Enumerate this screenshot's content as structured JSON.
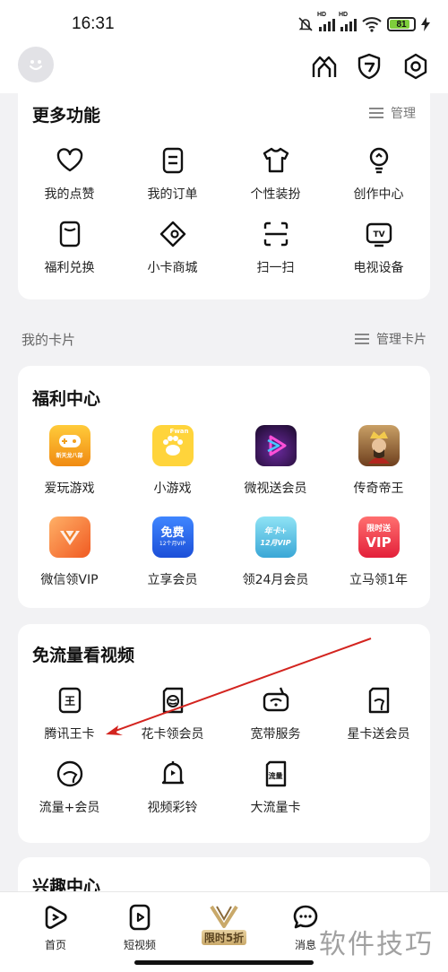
{
  "status_bar": {
    "time": "16:31",
    "battery": "81",
    "hd": "HD"
  },
  "top_bar": {
    "icons": [
      "avatar-icon",
      "pixel-icon",
      "shield-icon",
      "settings-icon"
    ]
  },
  "more_functions": {
    "title": "更多功能",
    "manage": "管理",
    "items": [
      {
        "label": "我的点赞",
        "icon": "heart-icon"
      },
      {
        "label": "我的订单",
        "icon": "order-icon"
      },
      {
        "label": "个性装扮",
        "icon": "tshirt-icon"
      },
      {
        "label": "创作中心",
        "icon": "bulb-icon"
      },
      {
        "label": "福利兑换",
        "icon": "exchange-icon"
      },
      {
        "label": "小卡商城",
        "icon": "ticket-icon"
      },
      {
        "label": "扫一扫",
        "icon": "scan-icon"
      },
      {
        "label": "电视设备",
        "icon": "tv-icon"
      }
    ]
  },
  "my_cards": {
    "label": "我的卡片",
    "manage": "管理卡片"
  },
  "welfare": {
    "title": "福利中心",
    "items": [
      {
        "label": "爱玩游戏",
        "icon": "game-icon",
        "color": "#f7b21c",
        "badge": "新天龙八部"
      },
      {
        "label": "小游戏",
        "icon": "mini-game-icon",
        "color": "#ffd43b",
        "badge": "Fwan"
      },
      {
        "label": "微视送会员",
        "icon": "weishi-icon",
        "color": "#2b1142",
        "badge": ""
      },
      {
        "label": "传奇帝王",
        "icon": "emperor-icon",
        "color": "#a87a44",
        "badge": ""
      },
      {
        "label": "微信领VIP",
        "icon": "wechat-vip-icon",
        "color": "#f7813a",
        "badge": ""
      },
      {
        "label": "立享会员",
        "icon": "free-vip-icon",
        "color": "#2d6cf5",
        "badge": "免费",
        "sub": "12个月VIP"
      },
      {
        "label": "领24月会员",
        "icon": "year-card-icon",
        "color": "#5ec8e6",
        "badge": "年卡+",
        "sub": "12月VIP"
      },
      {
        "label": "立马领1年",
        "icon": "limited-vip-icon",
        "color": "#f03a4c",
        "badge": "限时送",
        "sub": "VIP"
      }
    ]
  },
  "free_flow": {
    "title": "免流量看视频",
    "items": [
      {
        "label": "腾讯王卡",
        "icon": "wangka-icon"
      },
      {
        "label": "花卡领会员",
        "icon": "huaka-icon"
      },
      {
        "label": "宽带服务",
        "icon": "router-icon"
      },
      {
        "label": "星卡送会员",
        "icon": "telecom-card-icon"
      },
      {
        "label": "流量+会员",
        "icon": "telecom-icon"
      },
      {
        "label": "视频彩铃",
        "icon": "bell-icon"
      },
      {
        "label": "大流量卡",
        "icon": "sim-icon",
        "tag": "流量"
      }
    ]
  },
  "interest": {
    "title": "兴趣中心"
  },
  "bottom_nav": {
    "items": [
      {
        "label": "首页",
        "icon": "home-play-icon"
      },
      {
        "label": "短视频",
        "icon": "short-video-icon"
      },
      {
        "label": "限时5折",
        "icon": "vip-icon",
        "badge": "VIP"
      },
      {
        "label": "消息",
        "icon": "message-icon"
      }
    ]
  },
  "watermark": "软件技巧"
}
